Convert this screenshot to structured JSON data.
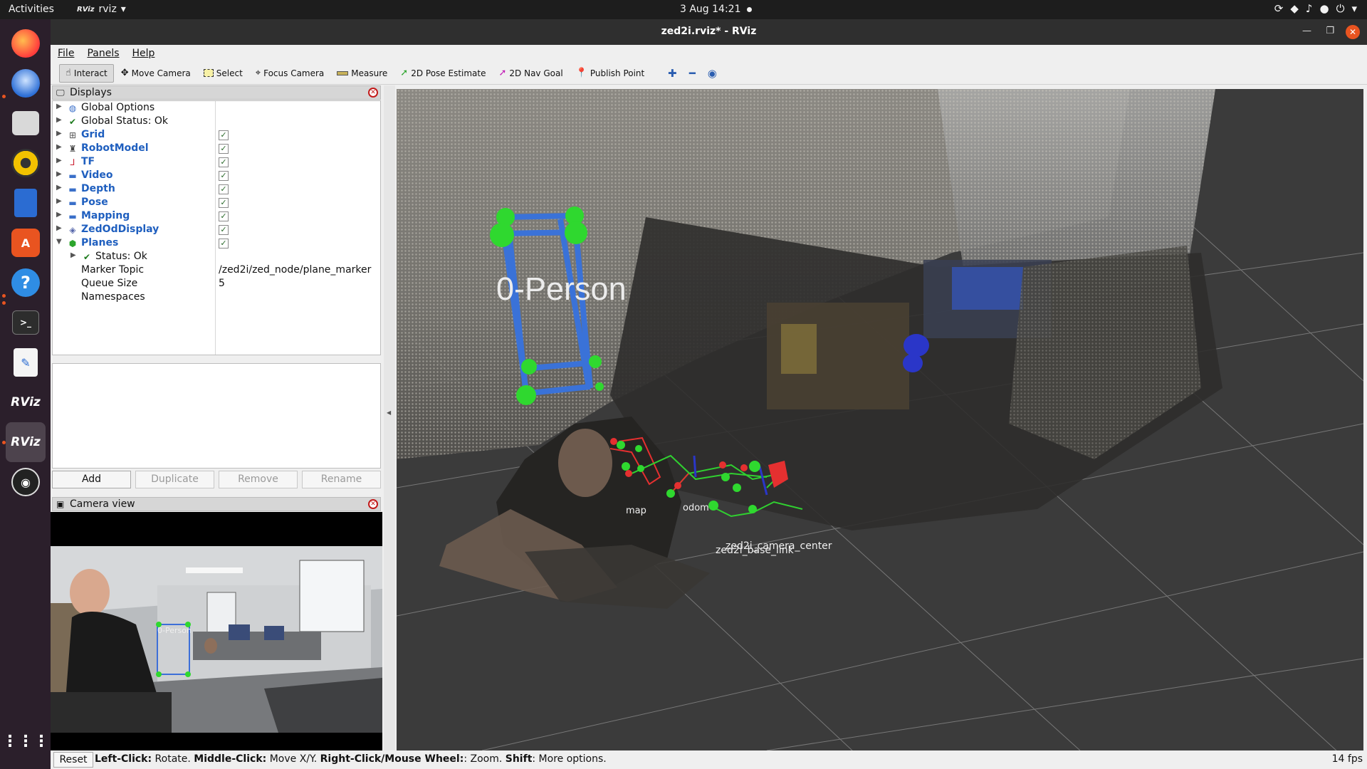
{
  "topbar": {
    "activities": "Activities",
    "app_name": "rviz",
    "app_badge": "RViz",
    "clock": "3 Aug  14:21"
  },
  "window": {
    "title": "zed2i.rviz* - RViz"
  },
  "menubar": {
    "file": "File",
    "panels": "Panels",
    "help": "Help"
  },
  "toolbar": {
    "interact": "Interact",
    "move_camera": "Move Camera",
    "select": "Select",
    "focus_camera": "Focus Camera",
    "measure": "Measure",
    "pose_estimate": "2D Pose Estimate",
    "nav_goal": "2D Nav Goal",
    "publish_point": "Publish Point"
  },
  "displays": {
    "title": "Displays",
    "items": [
      {
        "label": "Global Options"
      },
      {
        "label": "Global Status: Ok"
      },
      {
        "label": "Grid"
      },
      {
        "label": "RobotModel"
      },
      {
        "label": "TF"
      },
      {
        "label": "Video"
      },
      {
        "label": "Depth"
      },
      {
        "label": "Pose"
      },
      {
        "label": "Mapping"
      },
      {
        "label": "ZedOdDisplay"
      },
      {
        "label": "Planes"
      },
      {
        "label": "Status: Ok"
      },
      {
        "label": "Marker Topic",
        "value": "/zed2i/zed_node/plane_marker"
      },
      {
        "label": "Queue Size",
        "value": "5"
      },
      {
        "label": "Namespaces"
      }
    ],
    "buttons": {
      "add": "Add",
      "duplicate": "Duplicate",
      "remove": "Remove",
      "rename": "Rename"
    }
  },
  "camera_view": {
    "title": "Camera view",
    "overlay_label": "0-Person"
  },
  "scene": {
    "object_label": "0-Person",
    "frames": {
      "map": "map",
      "odom": "odom",
      "camera_center": "zed2i_camera_center",
      "base_link": "zed2i_base_link"
    }
  },
  "status": {
    "reset": "Reset",
    "hint_parts": [
      {
        "b": "Left-Click:",
        "t": " Rotate. "
      },
      {
        "b": "Middle-Click:",
        "t": " Move X/Y. "
      },
      {
        "b": "Right-Click/Mouse Wheel:",
        "t": ": Zoom. "
      },
      {
        "b": "Shift",
        "t": ": More options."
      }
    ],
    "fps": "14 fps"
  }
}
